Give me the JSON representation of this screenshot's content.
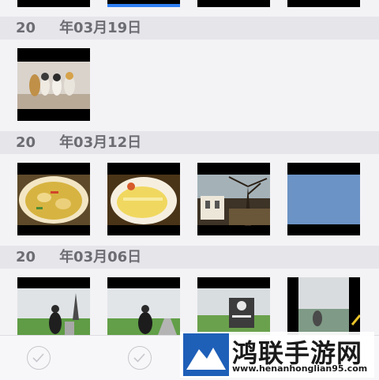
{
  "sections": [
    {
      "date_label_year": "20",
      "date_label_rest": "年03月19日"
    },
    {
      "date_label_year": "20",
      "date_label_rest": "年03月12日"
    },
    {
      "date_label_year": "20",
      "date_label_rest": "年03月06日"
    }
  ],
  "photos": {
    "mar19": [
      "toy-figurines-photo"
    ],
    "mar12": [
      "chicken-curry-photo",
      "omelette-rice-photo",
      "tree-building-photo",
      "blue-sky-photo"
    ],
    "mar06": [
      "person-park-photo",
      "person-path-photo",
      "signboard-photo",
      "glass-building-photo"
    ]
  },
  "watermark": {
    "title": "鸿联手游网",
    "url": "www.henanhonglian95.com"
  },
  "colors": {
    "header_bg": "#e6e5ea",
    "header_text": "#6c6c73",
    "selected_accent": "#2f7ff2"
  }
}
